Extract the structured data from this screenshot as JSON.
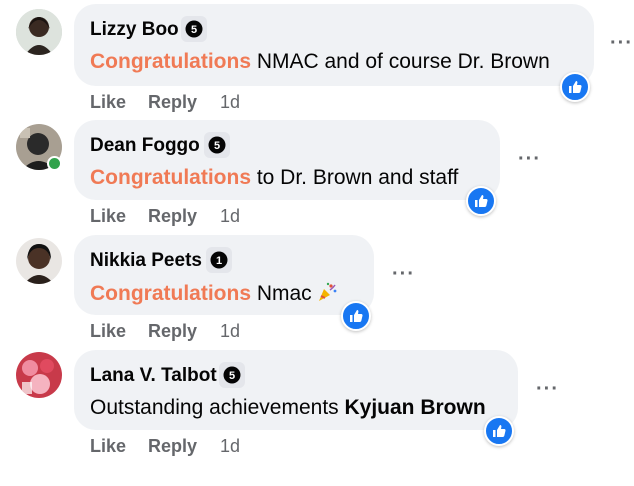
{
  "comments": [
    {
      "author": "Lizzy Boo",
      "badge": "5",
      "highlight": "Congratulations",
      "text": " NMAC and of course Dr. Brown",
      "like": "Like",
      "reply": "Reply",
      "time": "1d",
      "reaction_icon": "thumbs-up-icon"
    },
    {
      "author": "Dean Foggo",
      "badge": "5",
      "highlight": "Congratulations",
      "text": " to Dr. Brown and staff",
      "like": "Like",
      "reply": "Reply",
      "time": "1d",
      "online": true,
      "reaction_icon": "thumbs-up-icon"
    },
    {
      "author": "Nikkia Peets",
      "badge": "1",
      "highlight": "Congratulations",
      "text": " Nmac",
      "emoji": "party-popper-icon",
      "like": "Like",
      "reply": "Reply",
      "time": "1d",
      "reaction_icon": "thumbs-up-icon"
    },
    {
      "author": "Lana V. Talbot",
      "badge": "5",
      "text": "Outstanding achievements ",
      "mention": "Kyjuan Brown",
      "like": "Like",
      "reply": "Reply",
      "time": "1d",
      "reaction_icon": "thumbs-up-icon"
    }
  ],
  "colors": {
    "highlight": "#f07a55",
    "reaction_blue": "#1877f2",
    "bubble_bg": "#f0f2f5",
    "meta_gray": "#65676b",
    "online_green": "#31a24c"
  }
}
